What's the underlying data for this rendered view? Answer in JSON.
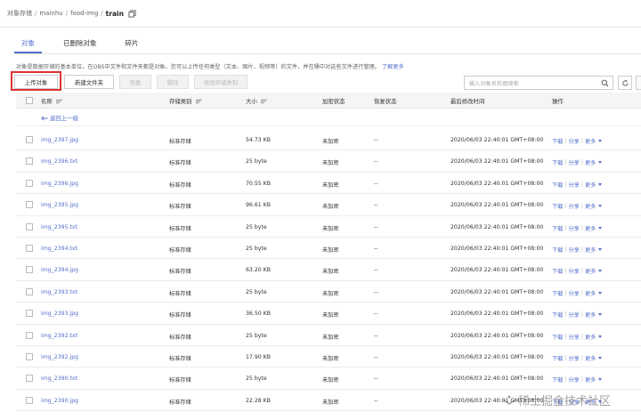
{
  "breadcrumb": {
    "items": [
      "对象存储",
      "mainhu",
      "food-img"
    ],
    "current": "train"
  },
  "tabs": [
    {
      "label": "对象",
      "active": true
    },
    {
      "label": "已删除对象",
      "active": false
    },
    {
      "label": "碎片",
      "active": false
    }
  ],
  "description": {
    "text": "对象是数据存储的基本单位，在OBS中文件和文件夹都是对象。您可以上传任何类型（文本、图片、视频等）的文件，并在桶中对这些文件进行管理。",
    "link": "了解更多"
  },
  "toolbar": {
    "upload": "上传对象",
    "new_folder": "新建文件夹",
    "restore": "恢复",
    "delete": "删除",
    "change_storage": "修改存储类别",
    "search_placeholder": "输入对象名前缀搜索"
  },
  "table": {
    "headers": {
      "name": "名称",
      "storage_class": "存储类别",
      "size": "大小",
      "encryption": "加密状态",
      "restore": "恢复状态",
      "modified": "最后修改时间",
      "actions": "操作"
    },
    "back_label": "返回上一级",
    "actions": {
      "download": "下载",
      "share": "分享",
      "more": "更多"
    },
    "rows": [
      {
        "name": "img_2397.jpg",
        "storage": "标准存储",
        "size": "54.73 KB",
        "enc": "未加密",
        "restore": "--",
        "modified": "2020/06/03 22:40:01 GMT+08:00"
      },
      {
        "name": "img_2396.txt",
        "storage": "标准存储",
        "size": "25 byte",
        "enc": "未加密",
        "restore": "--",
        "modified": "2020/06/03 22:40:01 GMT+08:00"
      },
      {
        "name": "img_2396.jpg",
        "storage": "标准存储",
        "size": "70.55 KB",
        "enc": "未加密",
        "restore": "--",
        "modified": "2020/06/03 22:40:01 GMT+08:00"
      },
      {
        "name": "img_2395.jpg",
        "storage": "标准存储",
        "size": "96.61 KB",
        "enc": "未加密",
        "restore": "--",
        "modified": "2020/06/03 22:40:01 GMT+08:00"
      },
      {
        "name": "img_2395.txt",
        "storage": "标准存储",
        "size": "25 byte",
        "enc": "未加密",
        "restore": "--",
        "modified": "2020/06/03 22:40:01 GMT+08:00"
      },
      {
        "name": "img_2394.txt",
        "storage": "标准存储",
        "size": "25 byte",
        "enc": "未加密",
        "restore": "--",
        "modified": "2020/06/03 22:40:01 GMT+08:00"
      },
      {
        "name": "img_2394.jpg",
        "storage": "标准存储",
        "size": "63.20 KB",
        "enc": "未加密",
        "restore": "--",
        "modified": "2020/06/03 22:40:01 GMT+08:00"
      },
      {
        "name": "img_2393.txt",
        "storage": "标准存储",
        "size": "25 byte",
        "enc": "未加密",
        "restore": "--",
        "modified": "2020/06/03 22:40:01 GMT+08:00"
      },
      {
        "name": "img_2393.jpg",
        "storage": "标准存储",
        "size": "36.50 KB",
        "enc": "未加密",
        "restore": "--",
        "modified": "2020/06/03 22:40:01 GMT+08:00"
      },
      {
        "name": "img_2392.txt",
        "storage": "标准存储",
        "size": "25 byte",
        "enc": "未加密",
        "restore": "--",
        "modified": "2020/06/03 22:40:01 GMT+08:00"
      },
      {
        "name": "img_2392.jpg",
        "storage": "标准存储",
        "size": "17.90 KB",
        "enc": "未加密",
        "restore": "--",
        "modified": "2020/06/03 22:40:01 GMT+08:00"
      },
      {
        "name": "img_2390.txt",
        "storage": "标准存储",
        "size": "25 byte",
        "enc": "未加密",
        "restore": "--",
        "modified": "2020/06/03 22:40:01 GMT+08:00"
      },
      {
        "name": "img_2390.jpg",
        "storage": "标准存储",
        "size": "22.28 KB",
        "enc": "未加密",
        "restore": "--",
        "modified": "2020/06/03 22:40:01 GMT+08:00"
      }
    ]
  },
  "watermark": "稀土掘金技术社区",
  "icons": {
    "copy": "copy-icon",
    "search": "search-icon",
    "refresh": "refresh-icon",
    "back": "back-arrow-icon",
    "sort": "sort-icon",
    "dropdown": "chevron-down-icon"
  },
  "colors": {
    "accent": "#526ecc",
    "highlight": "#dd3333"
  }
}
